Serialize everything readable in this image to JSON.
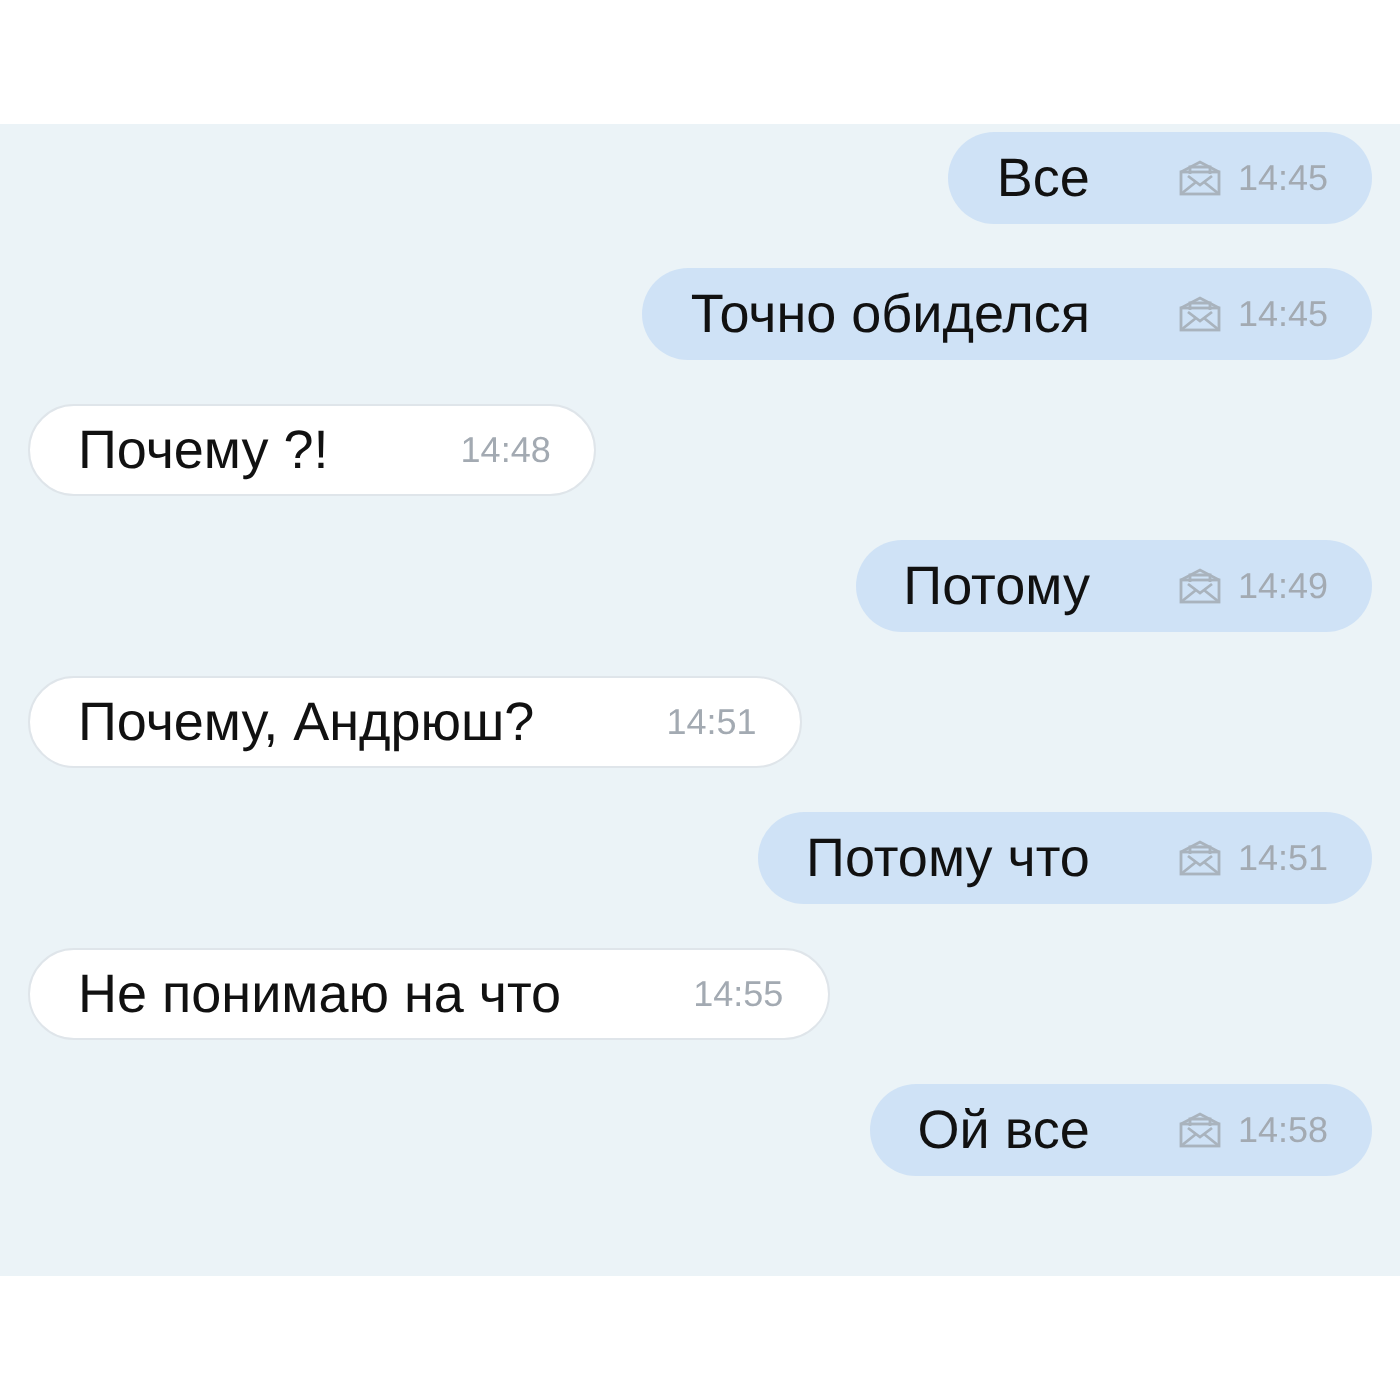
{
  "messages": [
    {
      "kind": "out",
      "text": "Все",
      "time": "14:45"
    },
    {
      "kind": "out",
      "text": "Точно обиделся",
      "time": "14:45"
    },
    {
      "kind": "in",
      "text": "Почему ?!",
      "time": "14:48"
    },
    {
      "kind": "out",
      "text": "Потому",
      "time": "14:49"
    },
    {
      "kind": "in",
      "text": "Почему, Андрюш?",
      "time": "14:51"
    },
    {
      "kind": "out",
      "text": "Потому что",
      "time": "14:51"
    },
    {
      "kind": "in",
      "text": "Не понимаю на что",
      "time": "14:55"
    },
    {
      "kind": "out",
      "text": "Ой все",
      "time": "14:58"
    }
  ]
}
